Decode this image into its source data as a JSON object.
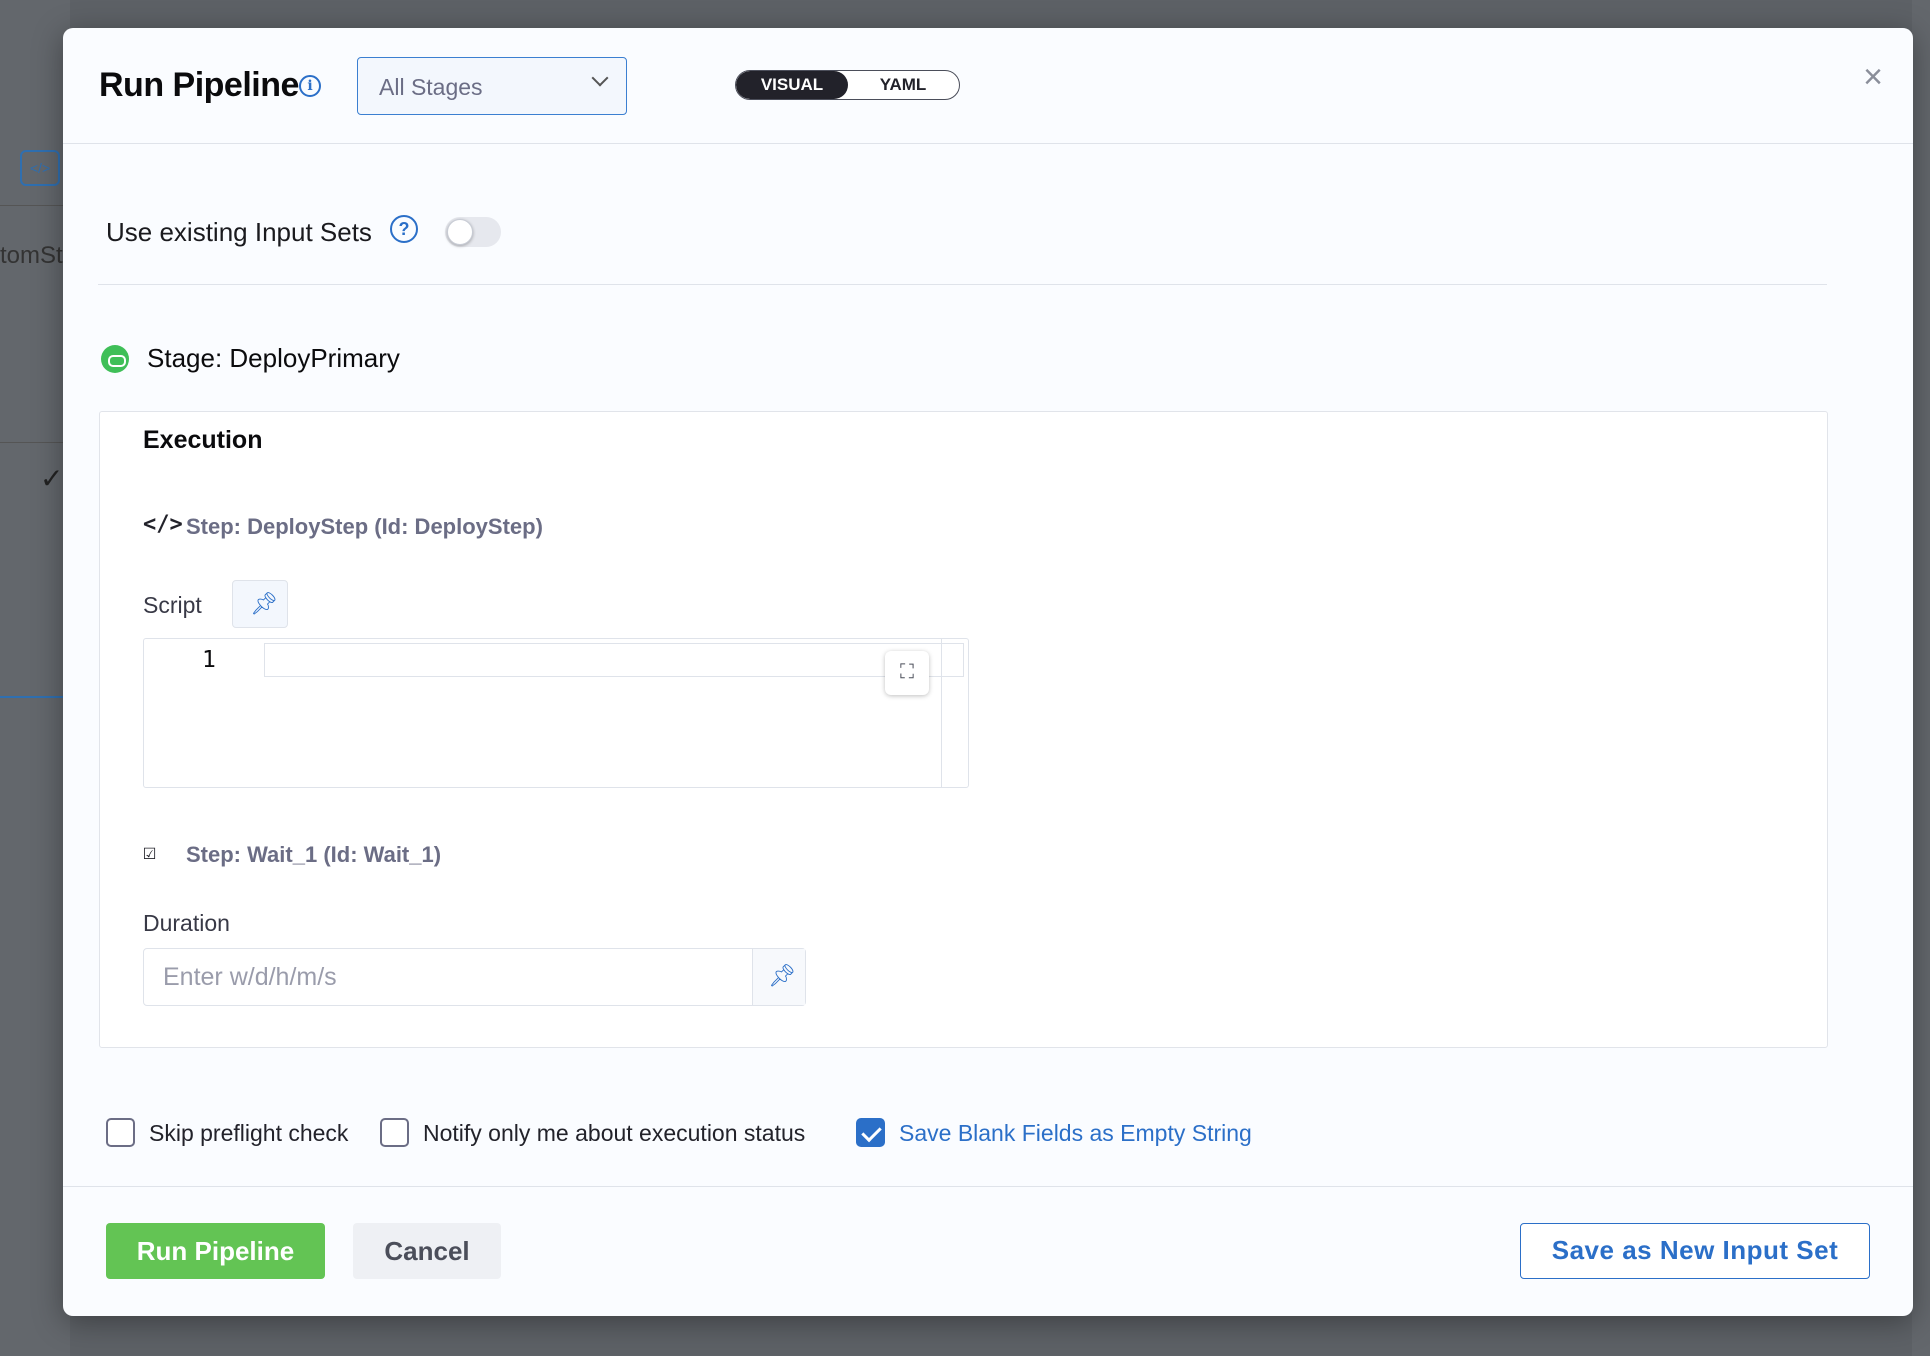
{
  "modal": {
    "title": "Run Pipeline",
    "stage_select": {
      "value": "All Stages"
    },
    "view_toggle": {
      "visual": "VISUAL",
      "yaml": "YAML",
      "selected": "VISUAL"
    },
    "close": "×"
  },
  "input_sets": {
    "label": "Use existing Input Sets",
    "help": "?",
    "enabled": false
  },
  "stage": {
    "label": "Stage: DeployPrimary"
  },
  "execution": {
    "title": "Execution",
    "step1": {
      "icon": "</>",
      "label": "Step: DeployStep (Id: DeployStep)",
      "field_label": "Script",
      "line_number": "1",
      "script_value": ""
    },
    "step2": {
      "icon": "☑",
      "label": "Step: Wait_1 (Id: Wait_1)",
      "field_label": "Duration",
      "placeholder": "Enter w/d/h/m/s",
      "value": ""
    }
  },
  "options": {
    "skip_preflight": {
      "label": "Skip preflight check",
      "checked": false
    },
    "notify_me": {
      "label": "Notify only me about execution status",
      "checked": false
    },
    "save_blank": {
      "label": "Save Blank Fields as Empty String",
      "checked": true
    }
  },
  "footer": {
    "run": "Run Pipeline",
    "cancel": "Cancel",
    "save_input_set": "Save as New Input Set"
  },
  "background": {
    "fragment_text": "tomSt"
  },
  "colors": {
    "primary_blue": "#2b6fc8",
    "run_green": "#63c454",
    "stage_green": "#3fbf58"
  }
}
